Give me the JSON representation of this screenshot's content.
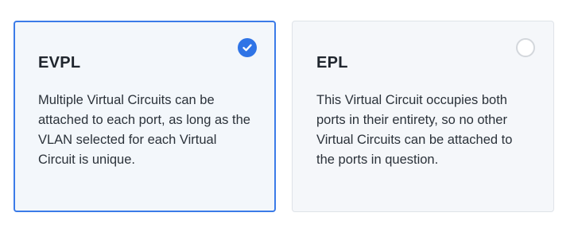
{
  "options": [
    {
      "title": "EVPL",
      "description": "Multiple Virtual Circuits can be attached to each port, as long as the VLAN selected for each Virtual Circuit is unique.",
      "selected": true
    },
    {
      "title": "EPL",
      "description": "This Virtual Circuit occupies both ports in their entirety, so no other Virtual Circuits can be attached to the ports in question.",
      "selected": false
    }
  ],
  "colors": {
    "accent": "#2f74e6",
    "selected_border": "#3b7be8",
    "selected_bg": "#f3f7fb",
    "unselected_bg": "#f5f7fa",
    "unselected_border": "#dfe3e8",
    "text": "#20262e"
  },
  "icons": {
    "checked_radio": "check-circle-icon",
    "empty_radio": "radio-unchecked-icon"
  }
}
